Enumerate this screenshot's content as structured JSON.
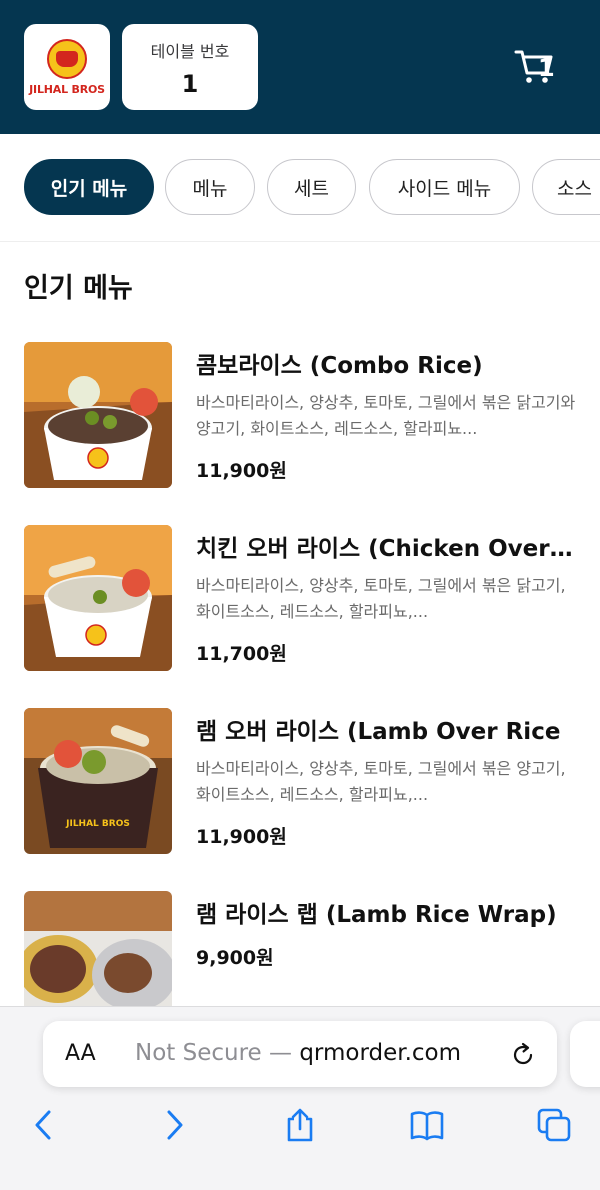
{
  "header": {
    "logo_text": "JILHAL BROS",
    "table_label": "테이블 번호",
    "table_number": "1",
    "cart_count": "1"
  },
  "categories": [
    {
      "label": "인기 메뉴",
      "active": true
    },
    {
      "label": "메뉴",
      "active": false
    },
    {
      "label": "세트",
      "active": false
    },
    {
      "label": "사이드 메뉴",
      "active": false
    },
    {
      "label": "소스",
      "active": false
    }
  ],
  "section_title": "인기 메뉴",
  "items": [
    {
      "name": "콤보라이스 (Combo Rice)",
      "desc": "바스마티라이스, 양상추, 토마토, 그릴에서 볶은 닭고기와 양고기, 화이트소스, 레드소스, 할라피뇨...",
      "price": "11,900원"
    },
    {
      "name": "치킨 오버 라이스 (Chicken Over ...",
      "desc": "바스마티라이스, 양상추, 토마토, 그릴에서 볶은 닭고기, 화이트소스, 레드소스, 할라피뇨,...",
      "price": "11,700원"
    },
    {
      "name": "램 오버 라이스 (Lamb Over Rice",
      "desc": "바스마티라이스, 양상추, 토마토, 그릴에서 볶은 양고기, 화이트소스, 레드소스, 할라피뇨,...",
      "price": "11,900원"
    },
    {
      "name": "램 라이스 랩 (Lamb Rice Wrap)",
      "desc": "",
      "price": "9,900원"
    }
  ],
  "browser": {
    "aa_label": "AA",
    "url_prefix": "Not Secure — ",
    "url_host": "qrmorder.com"
  },
  "colors": {
    "header_bg": "#053650",
    "logo_red": "#d3261e",
    "logo_yellow": "#f6c21a",
    "safari_blue": "#1a7cf2"
  }
}
